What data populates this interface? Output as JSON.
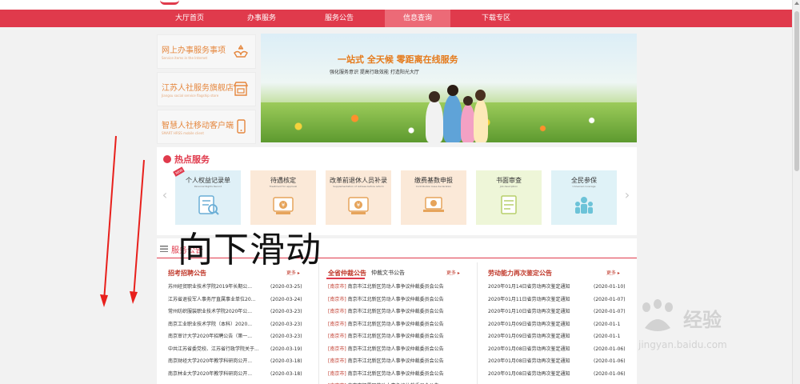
{
  "nav": {
    "items": [
      "大厅首页",
      "办事服务",
      "服务公告",
      "信息查询",
      "下载专区"
    ],
    "active_index": 3
  },
  "services": [
    {
      "title": "网上办事服务事项",
      "subtitle": "Service items in the Internet",
      "icon": "hands-service-icon"
    },
    {
      "title": "江苏人社服务旗舰店",
      "subtitle": "Jiangsu social service flagship store",
      "icon": "storefront-icon"
    },
    {
      "title": "智慧人社移动客户端",
      "subtitle": "SMART HRSS mobile client",
      "icon": "mobile-phone-icon"
    }
  ],
  "banner": {
    "title": "一站式  全天候  零距离在线服务",
    "subtitle": "强化服务意识    提高行政效能    打造阳光大厅"
  },
  "hot": {
    "heading": "热点服务",
    "cards": [
      {
        "title": "个人权益记录单",
        "subtitle": "Personal Rights Record",
        "badge": "NEW",
        "icon": "document-search-icon",
        "bg": "#dff0f7"
      },
      {
        "title": "待遇核定",
        "subtitle": "Treatment for approval",
        "icon": "money-bag-icon",
        "bg": "#fbe9d8"
      },
      {
        "title": "改革前退休人员补录",
        "subtitle": "Supplementation of retirees before reform",
        "icon": "money-bag-icon",
        "bg": "#fbe9d8"
      },
      {
        "title": "缴费基数申报",
        "subtitle": "Contribution base declaration",
        "icon": "laptop-money-icon",
        "bg": "#fbe9d8"
      },
      {
        "title": "书面审查",
        "subtitle": "Job description",
        "icon": "paper-review-icon",
        "bg": "#eef6d8"
      },
      {
        "title": "全民参保",
        "subtitle": "Universal coverage",
        "icon": "people-group-icon",
        "bg": "#dff2f7"
      }
    ]
  },
  "overlay_text": "向下滑动",
  "notice": {
    "heading": "服务公告",
    "more_label": "更多",
    "columns": [
      {
        "title": "招考招聘公告",
        "rows": [
          {
            "text": "苏州经贸职业技术学院2019年长期公...",
            "date": "(2020-03-25)"
          },
          {
            "text": "江苏省退役军人事务厅直属事业单位20...",
            "date": "(2020-03-24)"
          },
          {
            "text": "常州纺织服装职业技术学院2020年公...",
            "date": "(2020-03-23)"
          },
          {
            "text": "南京工业职业技术学院（本科）2020...",
            "date": "(2020-03-23)"
          },
          {
            "text": "南京审计大学2020年招聘公告（第一...",
            "date": "(2020-03-23)"
          },
          {
            "text": "中共江苏省委党校、江苏省行政学院关于...",
            "date": "(2020-03-19)"
          },
          {
            "text": "南京财经大学2020年教学科研岗公开...",
            "date": "(2020-03-18)"
          },
          {
            "text": "南京林业大学2020年教学科研岗公开...",
            "date": "(2020-03-18)"
          }
        ]
      },
      {
        "title": "全省仲裁公告",
        "tab2": "仲裁文书公告",
        "rows": [
          {
            "tag": "[南京市]",
            "text": "南京市江北新区劳动人事争议仲裁委员会公告"
          },
          {
            "tag": "[南京市]",
            "text": "南京市江北新区劳动人事争议仲裁委员会公告"
          },
          {
            "tag": "[南京市]",
            "text": "南京市江北新区劳动人事争议仲裁委员会公告"
          },
          {
            "tag": "[南京市]",
            "text": "南京市江北新区劳动人事争议仲裁委员会公告"
          },
          {
            "tag": "[南京市]",
            "text": "南京市江北新区劳动人事争议仲裁委员会公告"
          },
          {
            "tag": "[南京市]",
            "text": "南京市江北新区劳动人事争议仲裁委员会公告"
          },
          {
            "tag": "[南京市]",
            "text": "南京市江北新区劳动人事争议仲裁委员会公告"
          },
          {
            "tag": "[南京市]",
            "text": "南京市江北新区劳动人事争议仲裁委员会公告"
          },
          {
            "tag": "[南京市]",
            "text": "南京市栖霞区劳动人事争议仲裁委员会公告"
          }
        ]
      },
      {
        "title": "劳动能力再次鉴定公告",
        "rows": [
          {
            "text": "2020年01月14日省劳动再次鉴定通知",
            "date": "(2020-01-10)"
          },
          {
            "text": "2020年01月11日省劳动再次鉴定通知",
            "date": "(2020-01-07)"
          },
          {
            "text": "2020年01月10日省劳动再次鉴定通知",
            "date": "(2020-01-07)"
          },
          {
            "text": "2020年01月09日省劳动再次鉴定通知",
            "date": "(2020-01-1"
          },
          {
            "text": "2020年01月09日省劳动再次鉴定通知",
            "date": "(2020-01-1"
          },
          {
            "text": "2020年01月08日省劳动再次鉴定通知",
            "date": "(2020-01-06)"
          },
          {
            "text": "2020年01月08日省劳动再次鉴定通知",
            "date": "(2020-01-06)"
          },
          {
            "text": "2020年01月08日省劳动再次鉴定通知",
            "date": "(2020-01-06)"
          }
        ]
      }
    ]
  },
  "watermark": {
    "text": "经验",
    "sub": "jingyan.baidu.com"
  }
}
